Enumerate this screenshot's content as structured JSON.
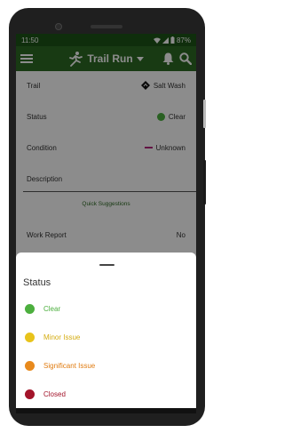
{
  "status_bar": {
    "time": "11:50",
    "battery": "87%"
  },
  "app_bar": {
    "title": "Trail Run",
    "colors": {
      "bar": "#2d6a24",
      "status": "#1c5416"
    }
  },
  "fields": {
    "trail": {
      "label": "Trail",
      "value": "Salt Wash",
      "icon": "diamond-trail-sign-icon"
    },
    "status": {
      "label": "Status",
      "value": "Clear",
      "color": "#4caf3e"
    },
    "condition": {
      "label": "Condition",
      "value": "Unknown",
      "color": "#b2267d"
    },
    "description": {
      "label": "Description",
      "value": ""
    },
    "quick_suggestions": "Quick Suggestions",
    "work_report": {
      "label": "Work Report",
      "value": "No"
    }
  },
  "sheet": {
    "title": "Status",
    "options": [
      {
        "label": "Clear",
        "color": "#4caf3e"
      },
      {
        "label": "Minor Issue",
        "color": "#e8c31b"
      },
      {
        "label": "Significant Issue",
        "color": "#e88a1d"
      },
      {
        "label": "Closed",
        "color": "#a3142a"
      }
    ]
  }
}
